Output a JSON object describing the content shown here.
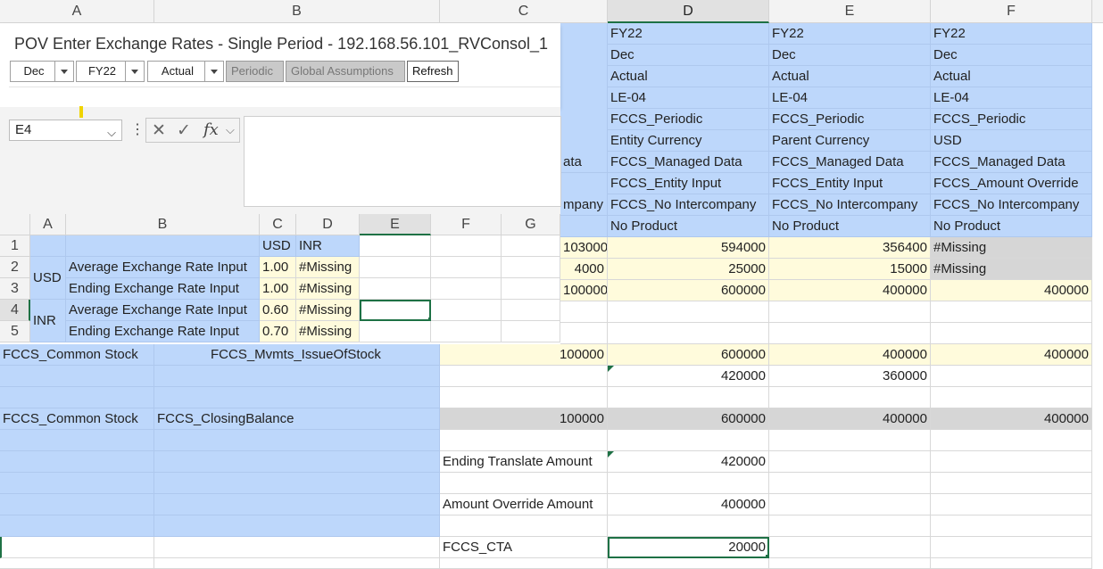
{
  "column_headers": [
    "A",
    "B",
    "C",
    "D",
    "E",
    "F"
  ],
  "header_rows": {
    "D": [
      "FY22",
      "Dec",
      "Actual",
      "LE-04",
      "FCCS_Periodic",
      "Entity Currency",
      "FCCS_Managed Data",
      "FCCS_Entity Input",
      "FCCS_No Intercompany",
      "No Product"
    ],
    "E": [
      "FY22",
      "Dec",
      "Actual",
      "LE-04",
      "FCCS_Periodic",
      "Parent Currency",
      "FCCS_Managed Data",
      "FCCS_Entity Input",
      "FCCS_No Intercompany",
      "No Product"
    ],
    "F": [
      "FY22",
      "Dec",
      "Actual",
      "LE-04",
      "FCCS_Periodic",
      "USD",
      "FCCS_Managed Data",
      "FCCS_Amount Override",
      "FCCS_No Intercompany",
      "No Product"
    ],
    "C_partial": [
      "ata",
      "mpany"
    ]
  },
  "data_rows": {
    "r1": {
      "c": "103000",
      "d": "594000",
      "e": "356400",
      "f": "#Missing"
    },
    "r2": {
      "c": "4000",
      "d": "25000",
      "e": "15000",
      "f": "#Missing"
    },
    "r3": {
      "c": "100000",
      "d": "600000",
      "e": "400000",
      "f": "400000"
    },
    "r6": {
      "a": "FCCS_Common Stock",
      "b": "FCCS_Mvmts_IssueOfStock",
      "c": "100000",
      "d": "600000",
      "e": "400000",
      "f": "400000"
    },
    "r7": {
      "d": "420000",
      "e": "360000"
    },
    "r9": {
      "a": "FCCS_Common Stock",
      "b": "FCCS_ClosingBalance",
      "c": "100000",
      "d": "600000",
      "e": "400000",
      "f": "400000"
    },
    "r11": {
      "c": "Ending Translate Amount",
      "d": "420000"
    },
    "r13": {
      "c": "Amount Override Amount",
      "d": "400000"
    },
    "r15": {
      "c": "FCCS_CTA",
      "d": "20000"
    }
  },
  "pov": {
    "title": "POV Enter Exchange Rates - Single Period - 192.168.56.101_RVConsol_1",
    "period": "Dec",
    "year": "FY22",
    "scenario": "Actual",
    "periodic_label": "Periodic",
    "global_assumptions_label": "Global Assumptions",
    "refresh_label": "Refresh"
  },
  "formula_bar": {
    "name_box": "E4",
    "dots": "⋮",
    "cancel_icon": "✕",
    "enter_icon": "✓",
    "fx_label": "fx",
    "chevron": "⌵",
    "value": ""
  },
  "inset_sheet": {
    "column_headers": [
      "A",
      "B",
      "C",
      "D",
      "E",
      "F",
      "G"
    ],
    "row_headers": [
      "1",
      "2",
      "3",
      "4",
      "5"
    ],
    "currency_header_usd": "USD",
    "currency_header_inr": "INR",
    "group_usd": "USD",
    "group_inr": "INR",
    "rows": [
      {
        "label": "Average Exchange Rate Input",
        "usd": "1.00",
        "inr": "#Missing"
      },
      {
        "label": "Ending Exchange Rate Input",
        "usd": "1.00",
        "inr": "#Missing"
      },
      {
        "label": "Average Exchange Rate Input",
        "usd": "0.60",
        "inr": "#Missing"
      },
      {
        "label": "Ending Exchange Rate Input",
        "usd": "0.70",
        "inr": "#Missing"
      }
    ]
  },
  "colors": {
    "header_blue": "#bdd7fb",
    "input_yellow": "#fffbdc",
    "calc_gray": "#d6d6d6",
    "selection_green": "#1e7145"
  }
}
